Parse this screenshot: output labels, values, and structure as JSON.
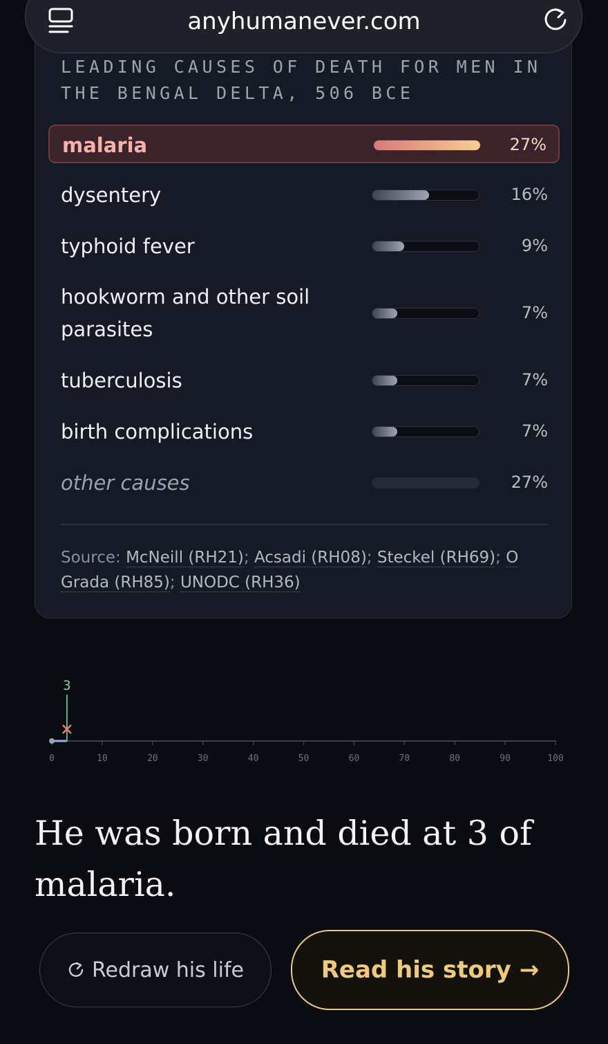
{
  "browser": {
    "url": "anyhumanever.com",
    "tab_icon": "tabs-icon",
    "reload_icon": "reload-icon"
  },
  "causes_card": {
    "title": "LEADING CAUSES OF DEATH FOR MEN IN THE BENGAL DELTA, 506 BCE",
    "items": [
      {
        "label": "malaria",
        "percent_text": "27%",
        "value": 27,
        "highlight": true
      },
      {
        "label": "dysentery",
        "percent_text": "16%",
        "value": 16
      },
      {
        "label": "typhoid fever",
        "percent_text": "9%",
        "value": 9
      },
      {
        "label": "hookworm and other soil parasites",
        "percent_text": "7%",
        "value": 7
      },
      {
        "label": "tuberculosis",
        "percent_text": "7%",
        "value": 7
      },
      {
        "label": "birth complications",
        "percent_text": "7%",
        "value": 7
      },
      {
        "label": "other causes",
        "percent_text": "27%",
        "value": 27,
        "other": true
      }
    ],
    "source_label": "Source:",
    "sources": [
      "McNeill (RH21)",
      "Acsadi (RH08)",
      "Steckel (RH69)",
      "O Grada (RH85)",
      "UNODC (RH36)"
    ],
    "source_separator": ";"
  },
  "timeline": {
    "marker_label": "3",
    "marker_age": 3,
    "range": [
      0,
      100
    ],
    "ticks": [
      "0",
      "10",
      "20",
      "30",
      "40",
      "50",
      "60",
      "70",
      "80",
      "90",
      "100"
    ],
    "colors": {
      "axis": "#3a3f4b",
      "marker": "#7fd3a0",
      "death": "#e07b79",
      "life": "#8fb2e8"
    }
  },
  "story": {
    "sentence": "He was born and died at 3 of malaria."
  },
  "actions": {
    "redraw_label": "Redraw his life",
    "read_label": "Read his story",
    "read_arrow": "→"
  },
  "colors": {
    "accent": "#eec97e",
    "highlight_bg": "#3a2329",
    "highlight_text": "#f3b2ac"
  }
}
